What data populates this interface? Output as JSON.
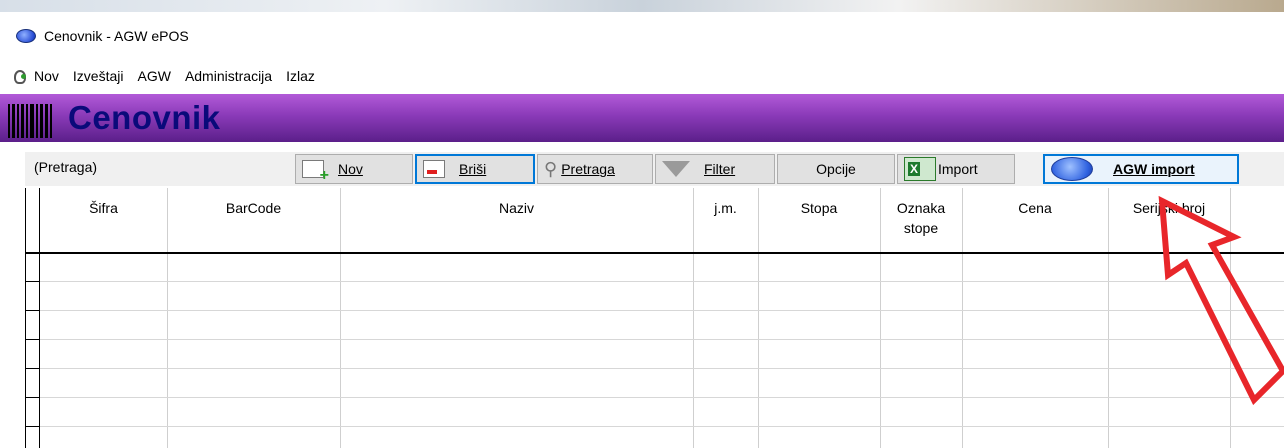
{
  "window": {
    "title": "Cenovnik - AGW ePOS"
  },
  "menu": {
    "items": [
      "Nov",
      "Izveštaji",
      "AGW",
      "Administracija",
      "Izlaz"
    ]
  },
  "banner": {
    "title": "Cenovnik"
  },
  "toolbar": {
    "search_placeholder": "(Pretraga)",
    "new_label": "Nov",
    "delete_label": "Briši",
    "search_label": "Pretraga",
    "filter_label": "Filter",
    "options_label": "Opcije",
    "import_label": "Import",
    "agw_import_label": "AGW import"
  },
  "table": {
    "columns": [
      "Šifra",
      "BarCode",
      "Naziv",
      "j.m.",
      "Stopa",
      "Oznaka stope",
      "Cena",
      "Serijski broj"
    ],
    "rows": []
  },
  "colors": {
    "banner_top": "#b25ad8",
    "banner_bottom": "#5b1f8a",
    "banner_text": "#0a0a7a",
    "focus": "#0078d7",
    "annotation_arrow": "#e8262a"
  }
}
